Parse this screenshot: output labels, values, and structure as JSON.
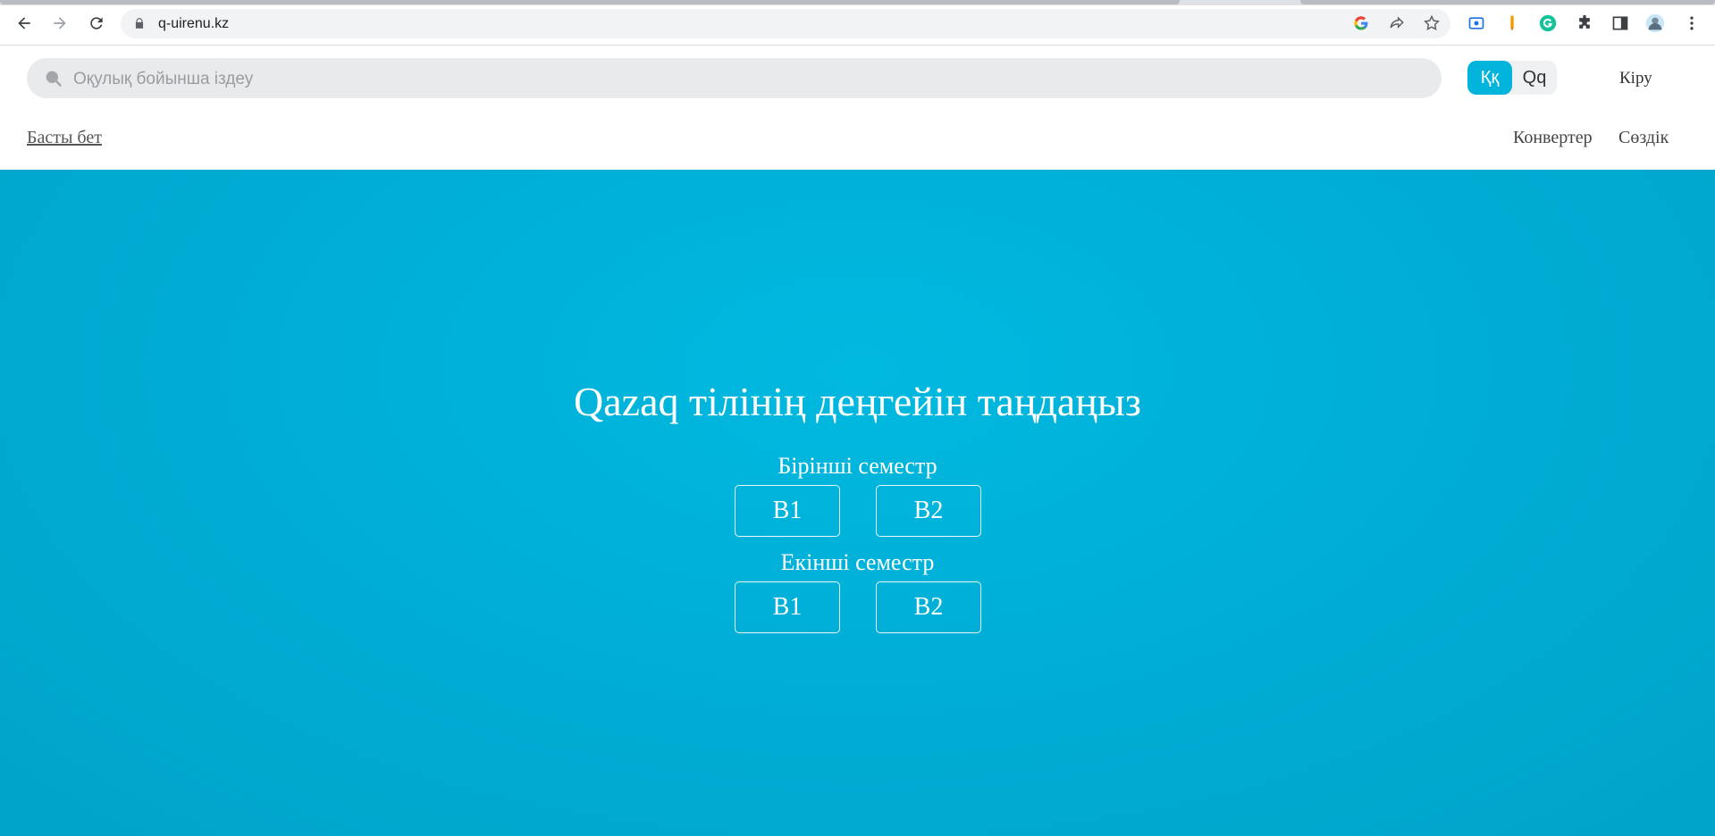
{
  "browser": {
    "url": "q-uirenu.kz"
  },
  "header": {
    "search_placeholder": "Оқулық бойынша іздеу",
    "lang_active": "Ққ",
    "lang_inactive": "Qq",
    "login": "Кіру",
    "home_link": "Басты бет",
    "nav_converter": "Конвертер",
    "nav_dictionary": "Сөздік"
  },
  "hero": {
    "title": "Qazaq тілінің деңгейін таңдаңыз",
    "semesters": [
      {
        "label": "Бірінші семестр",
        "levels": [
          "B1",
          "B2"
        ]
      },
      {
        "label": "Екінші семестр",
        "levels": [
          "B1",
          "B2"
        ]
      }
    ]
  },
  "colors": {
    "accent": "#00b4dc",
    "hero_bg": "#00aed6"
  }
}
